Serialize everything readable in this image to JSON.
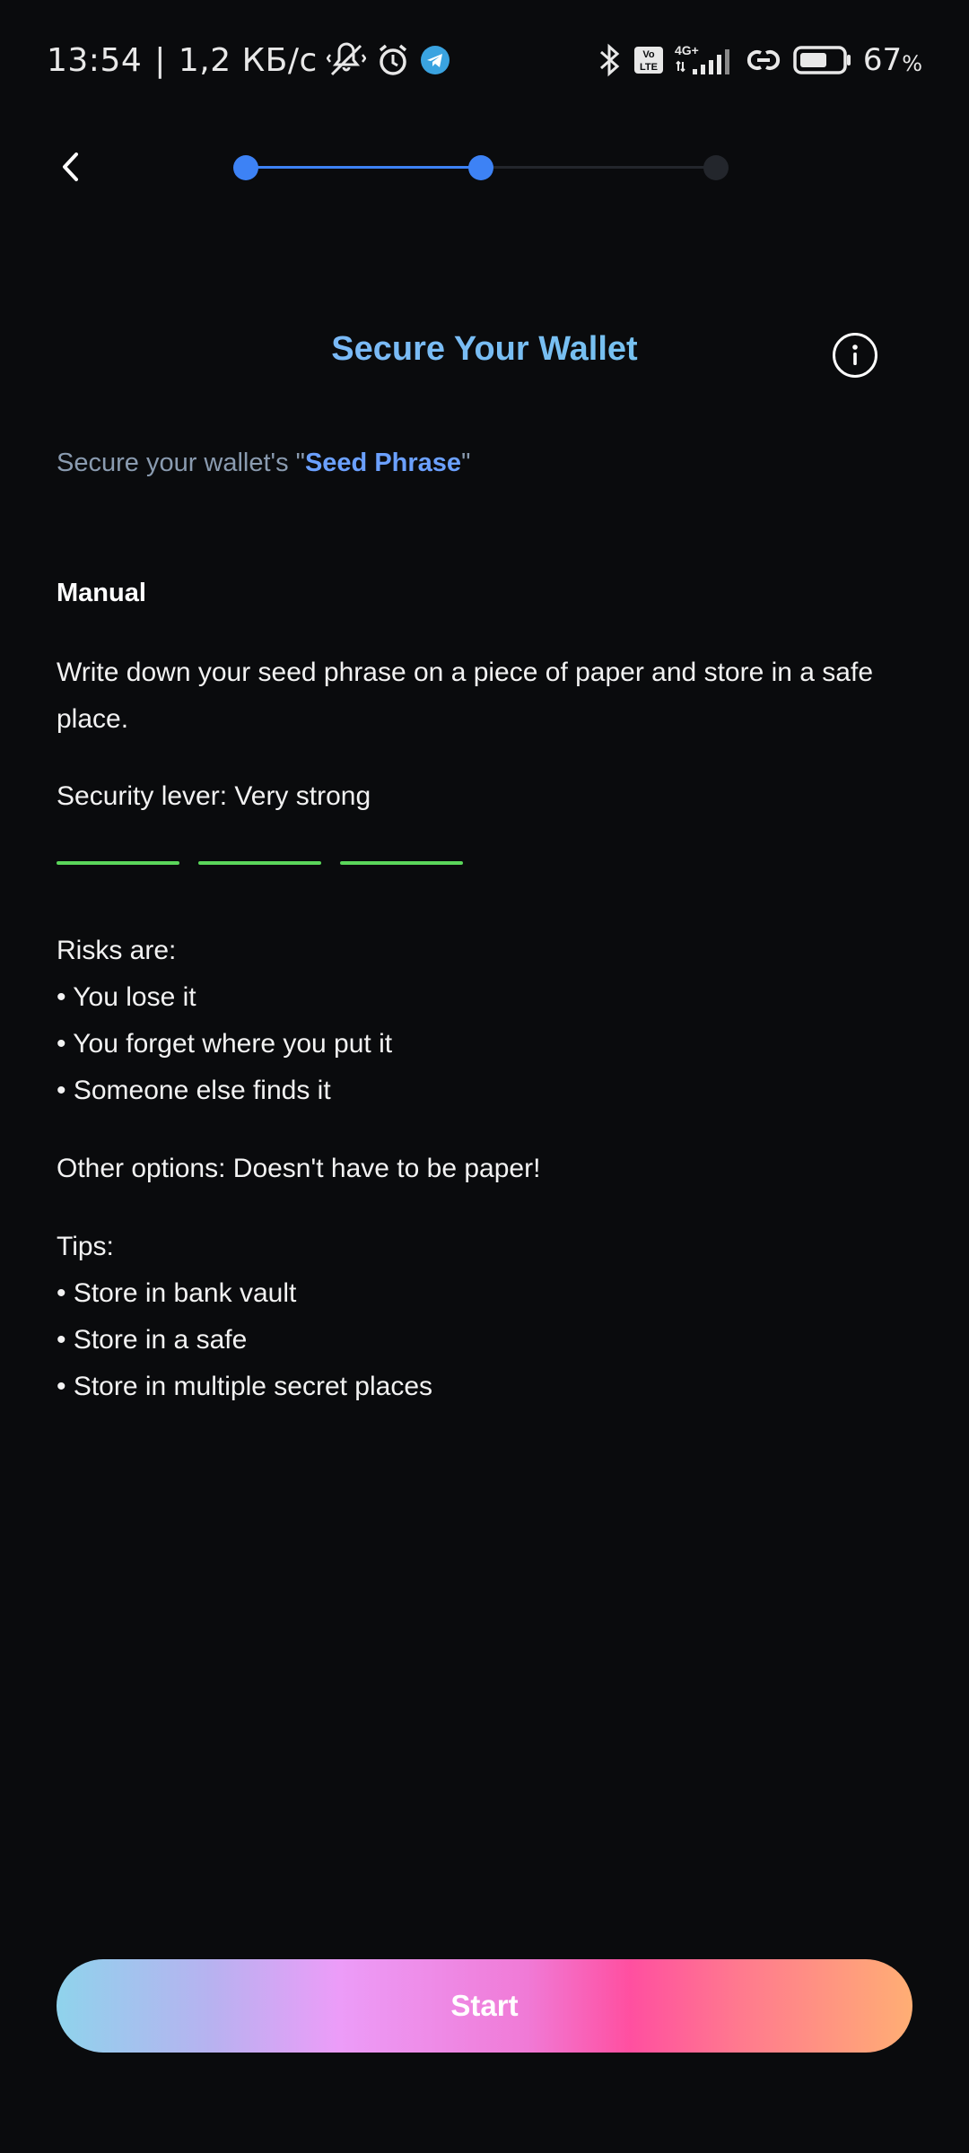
{
  "status_bar": {
    "time": "13:54",
    "separator": "|",
    "speed": "1,2 КБ/с",
    "network": "4G+",
    "volte": "Vo LTE",
    "battery_percent": "67",
    "battery_unit": "%",
    "battery_level": 0.67,
    "icons_left": [
      "vibrate-muted-icon",
      "alarm-icon",
      "telegram-icon"
    ],
    "icons_right": [
      "bluetooth-icon",
      "volte-icon",
      "signal-icon",
      "link-icon",
      "battery-icon"
    ]
  },
  "header": {
    "back_icon": "chevron-left-icon",
    "stepper": {
      "steps": 3,
      "current_step": 2
    }
  },
  "title": "Secure Your Wallet",
  "info_icon": "info-icon",
  "subtitle": {
    "prefix": "Secure your wallet's \"",
    "highlight": "Seed Phrase",
    "suffix": "\""
  },
  "manual": {
    "heading": "Manual",
    "description": "Write down your seed phrase on a piece of paper and store in a safe place.",
    "security_level": "Security lever: Very strong",
    "strength_bars": 3,
    "risks_heading": "Risks are:",
    "risks": [
      "• You lose it",
      "• You forget where you put it",
      "• Someone else finds it"
    ],
    "other_options": "Other options: Doesn't have to be paper!",
    "tips_heading": "Tips:",
    "tips": [
      "• Store in bank vault",
      "• Store in a safe",
      "• Store in multiple secret places"
    ]
  },
  "start_button": {
    "label": "Start"
  },
  "colors": {
    "background": "#0a0b0d",
    "accent_blue": "#3d82f5",
    "strength_green": "#5ad65a",
    "subtitle_gray": "#8a9bb0",
    "highlight_blue": "#6ba0ff"
  }
}
